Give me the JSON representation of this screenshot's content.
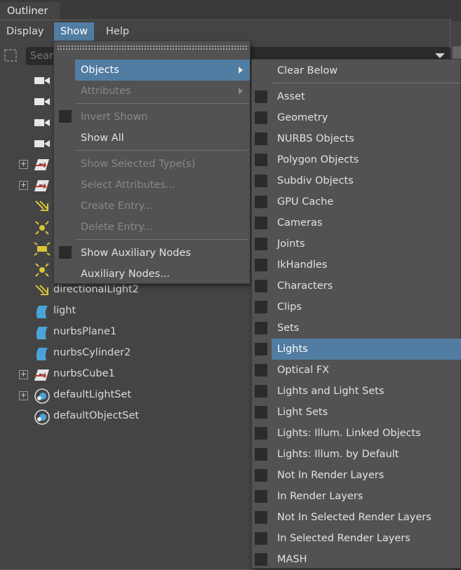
{
  "window": {
    "title": "Outliner"
  },
  "menubar": [
    "Display",
    "Show",
    "Help"
  ],
  "search": {
    "placeholder": "Search..."
  },
  "tree": [
    {
      "label": "",
      "icon": "camera-icon",
      "expandable": false
    },
    {
      "label": "",
      "icon": "camera-icon",
      "expandable": false
    },
    {
      "label": "",
      "icon": "camera-icon",
      "expandable": false
    },
    {
      "label": "",
      "icon": "camera-icon",
      "expandable": false
    },
    {
      "label": "",
      "icon": "nurbs-cube-icon",
      "expandable": true
    },
    {
      "label": "",
      "icon": "nurbs-cube-icon",
      "expandable": true
    },
    {
      "label": "",
      "icon": "directional-light-icon",
      "expandable": false
    },
    {
      "label": "",
      "icon": "point-light-icon",
      "expandable": false
    },
    {
      "label": "",
      "icon": "area-light-icon",
      "expandable": false
    },
    {
      "label": "",
      "icon": "point-light-icon",
      "expandable": false
    },
    {
      "label": "directionalLight2",
      "icon": "directional-light-icon",
      "expandable": false
    },
    {
      "label": "light",
      "icon": "nurbs-surface-icon",
      "expandable": false
    },
    {
      "label": "nurbsPlane1",
      "icon": "nurbs-surface-icon",
      "expandable": false
    },
    {
      "label": "nurbsCylinder2",
      "icon": "nurbs-surface-icon",
      "expandable": false
    },
    {
      "label": "nurbsCube1",
      "icon": "nurbs-cube-icon",
      "expandable": true
    },
    {
      "label": "defaultLightSet",
      "icon": "set-icon",
      "expandable": true
    },
    {
      "label": "defaultObjectSet",
      "icon": "set-icon",
      "expandable": false
    }
  ],
  "show_menu": {
    "items": [
      {
        "label": "Objects",
        "submenu": true,
        "highlighted": true
      },
      {
        "label": "Attributes",
        "submenu": true,
        "disabled": true
      },
      {
        "label": "Invert Shown",
        "disabled": true,
        "checkbox": true
      },
      {
        "label": "Show All"
      },
      {
        "label": "Show Selected Type(s)",
        "disabled": true
      },
      {
        "label": "Select Attributes...",
        "disabled": true
      },
      {
        "label": "Create Entry...",
        "disabled": true
      },
      {
        "label": "Delete Entry...",
        "disabled": true
      },
      {
        "label": "Show Auxiliary Nodes",
        "checkbox": true
      },
      {
        "label": "Auxiliary Nodes..."
      }
    ]
  },
  "objects_menu": {
    "header": "Clear Below",
    "items": [
      "Asset",
      "Geometry",
      "NURBS Objects",
      "Polygon Objects",
      "Subdiv Objects",
      "GPU Cache",
      "Cameras",
      "Joints",
      "IkHandles",
      "Characters",
      "Clips",
      "Sets",
      "Lights",
      "Optical FX",
      "Lights and Light Sets",
      "Light Sets",
      "Lights: Illum. Linked Objects",
      "Lights: Illum. by Default",
      "Not In Render Layers",
      "In Render Layers",
      "Not In Selected Render Layers",
      "In Selected Render Layers",
      "MASH"
    ],
    "highlighted": "Lights"
  },
  "colors": {
    "accent": "#527da2",
    "background": "#444444",
    "menu": "#525252"
  }
}
